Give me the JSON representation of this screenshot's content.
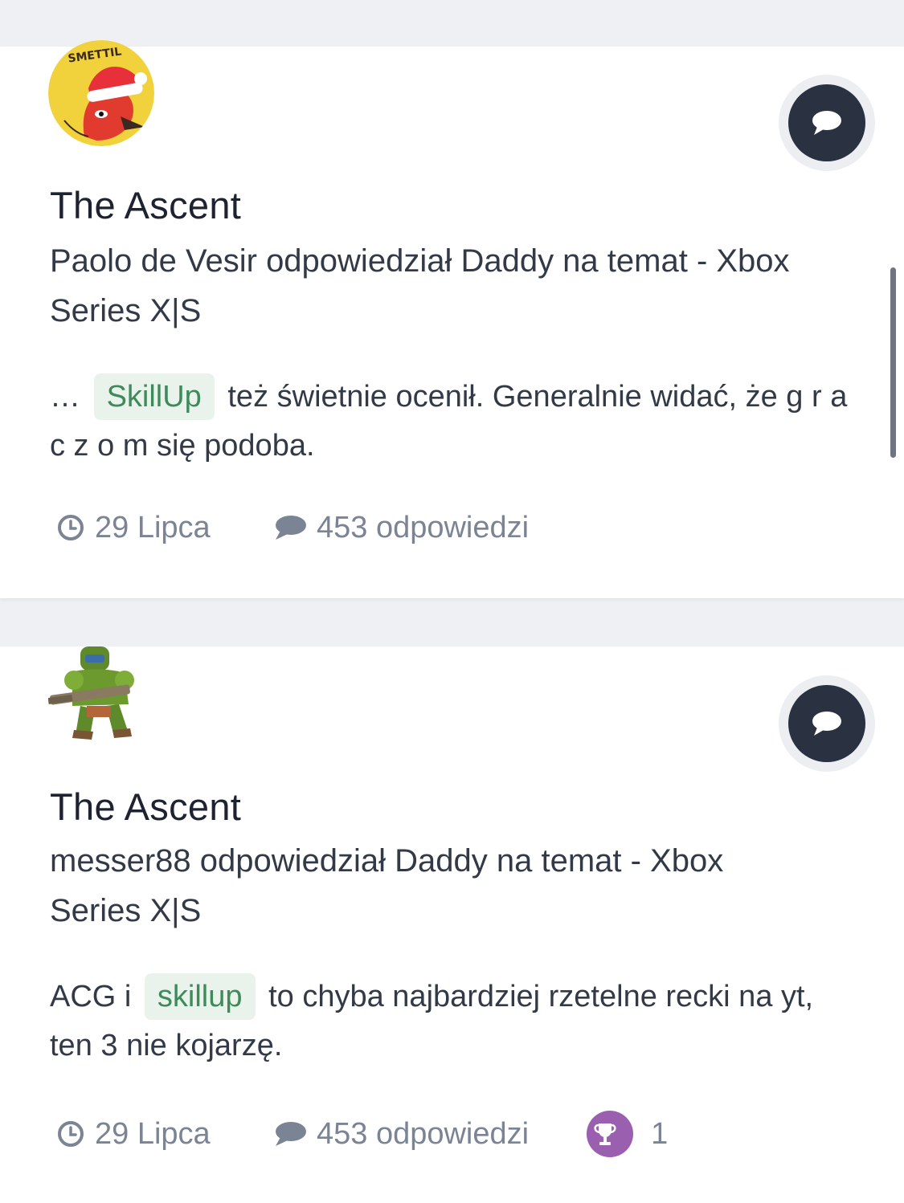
{
  "feed": [
    {
      "avatar": {
        "icon": "santa-hat-duck-avatar",
        "bg_color": "#f2d23c",
        "text": "SMETTIL"
      },
      "title": "The Ascent",
      "subtitle": "Paolo de Vesir odpowiedział Daddy na temat - Xbox Series X|S",
      "excerpt_before": "…",
      "tag": "SkillUp",
      "excerpt_after": "też świetnie ocenił. Generalnie widać, że g r a c z o m się podoba.",
      "date": "29 Lipca",
      "replies": "453 odpowiedzi",
      "comment_icon": "speech-bubble-icon"
    },
    {
      "avatar": {
        "icon": "doom-marine-avatar"
      },
      "title": "The Ascent",
      "subtitle": "messer88 odpowiedział Daddy na temat - Xbox Series X|S",
      "excerpt_before": "ACG i",
      "tag": "skillup",
      "excerpt_after": "to chyba najbardziej rzetelne recki na yt, ten 3 nie kojarzę.",
      "date": "29 Lipca",
      "replies": "453 odpowiedzi",
      "reactions": "1",
      "comment_icon": "speech-bubble-icon"
    }
  ],
  "colors": {
    "page_bg": "#eef0f3",
    "card_bg": "#ffffff",
    "tag_bg": "#e9f3ec",
    "tag_text": "#3f8a5a",
    "meta_text": "#7b8494",
    "comment_button": "#2a3140",
    "trophy": "#9b5fb0"
  }
}
